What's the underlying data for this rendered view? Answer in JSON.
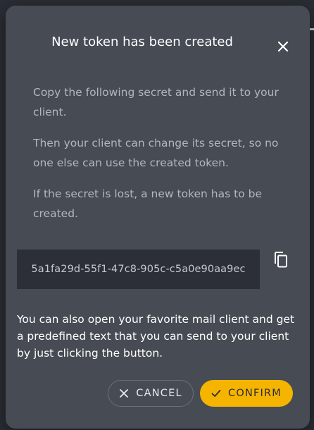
{
  "dialog": {
    "title": "New token has been created",
    "paragraphs": [
      "Copy the following secret and send it to your client.",
      "Then your client can change its secret, so no one else can use the created token.",
      "If the secret is lost, a new token has to be created."
    ],
    "secret": "5a1fa29d-55f1-47c8-905c-c5a0e90aa9ec",
    "info": "You can also open your favorite mail client and get a predefined text that you can send to your client by just clicking the button.",
    "cancel_label": "CANCEL",
    "confirm_label": "CONFIRM"
  },
  "icons": {
    "close": "close-icon",
    "copy": "copy-icon",
    "cancel": "close-icon",
    "confirm": "check-icon"
  },
  "colors": {
    "dialog_bg": "#474b54",
    "accent": "#f4b400",
    "secret_bg": "#2c2f37"
  }
}
